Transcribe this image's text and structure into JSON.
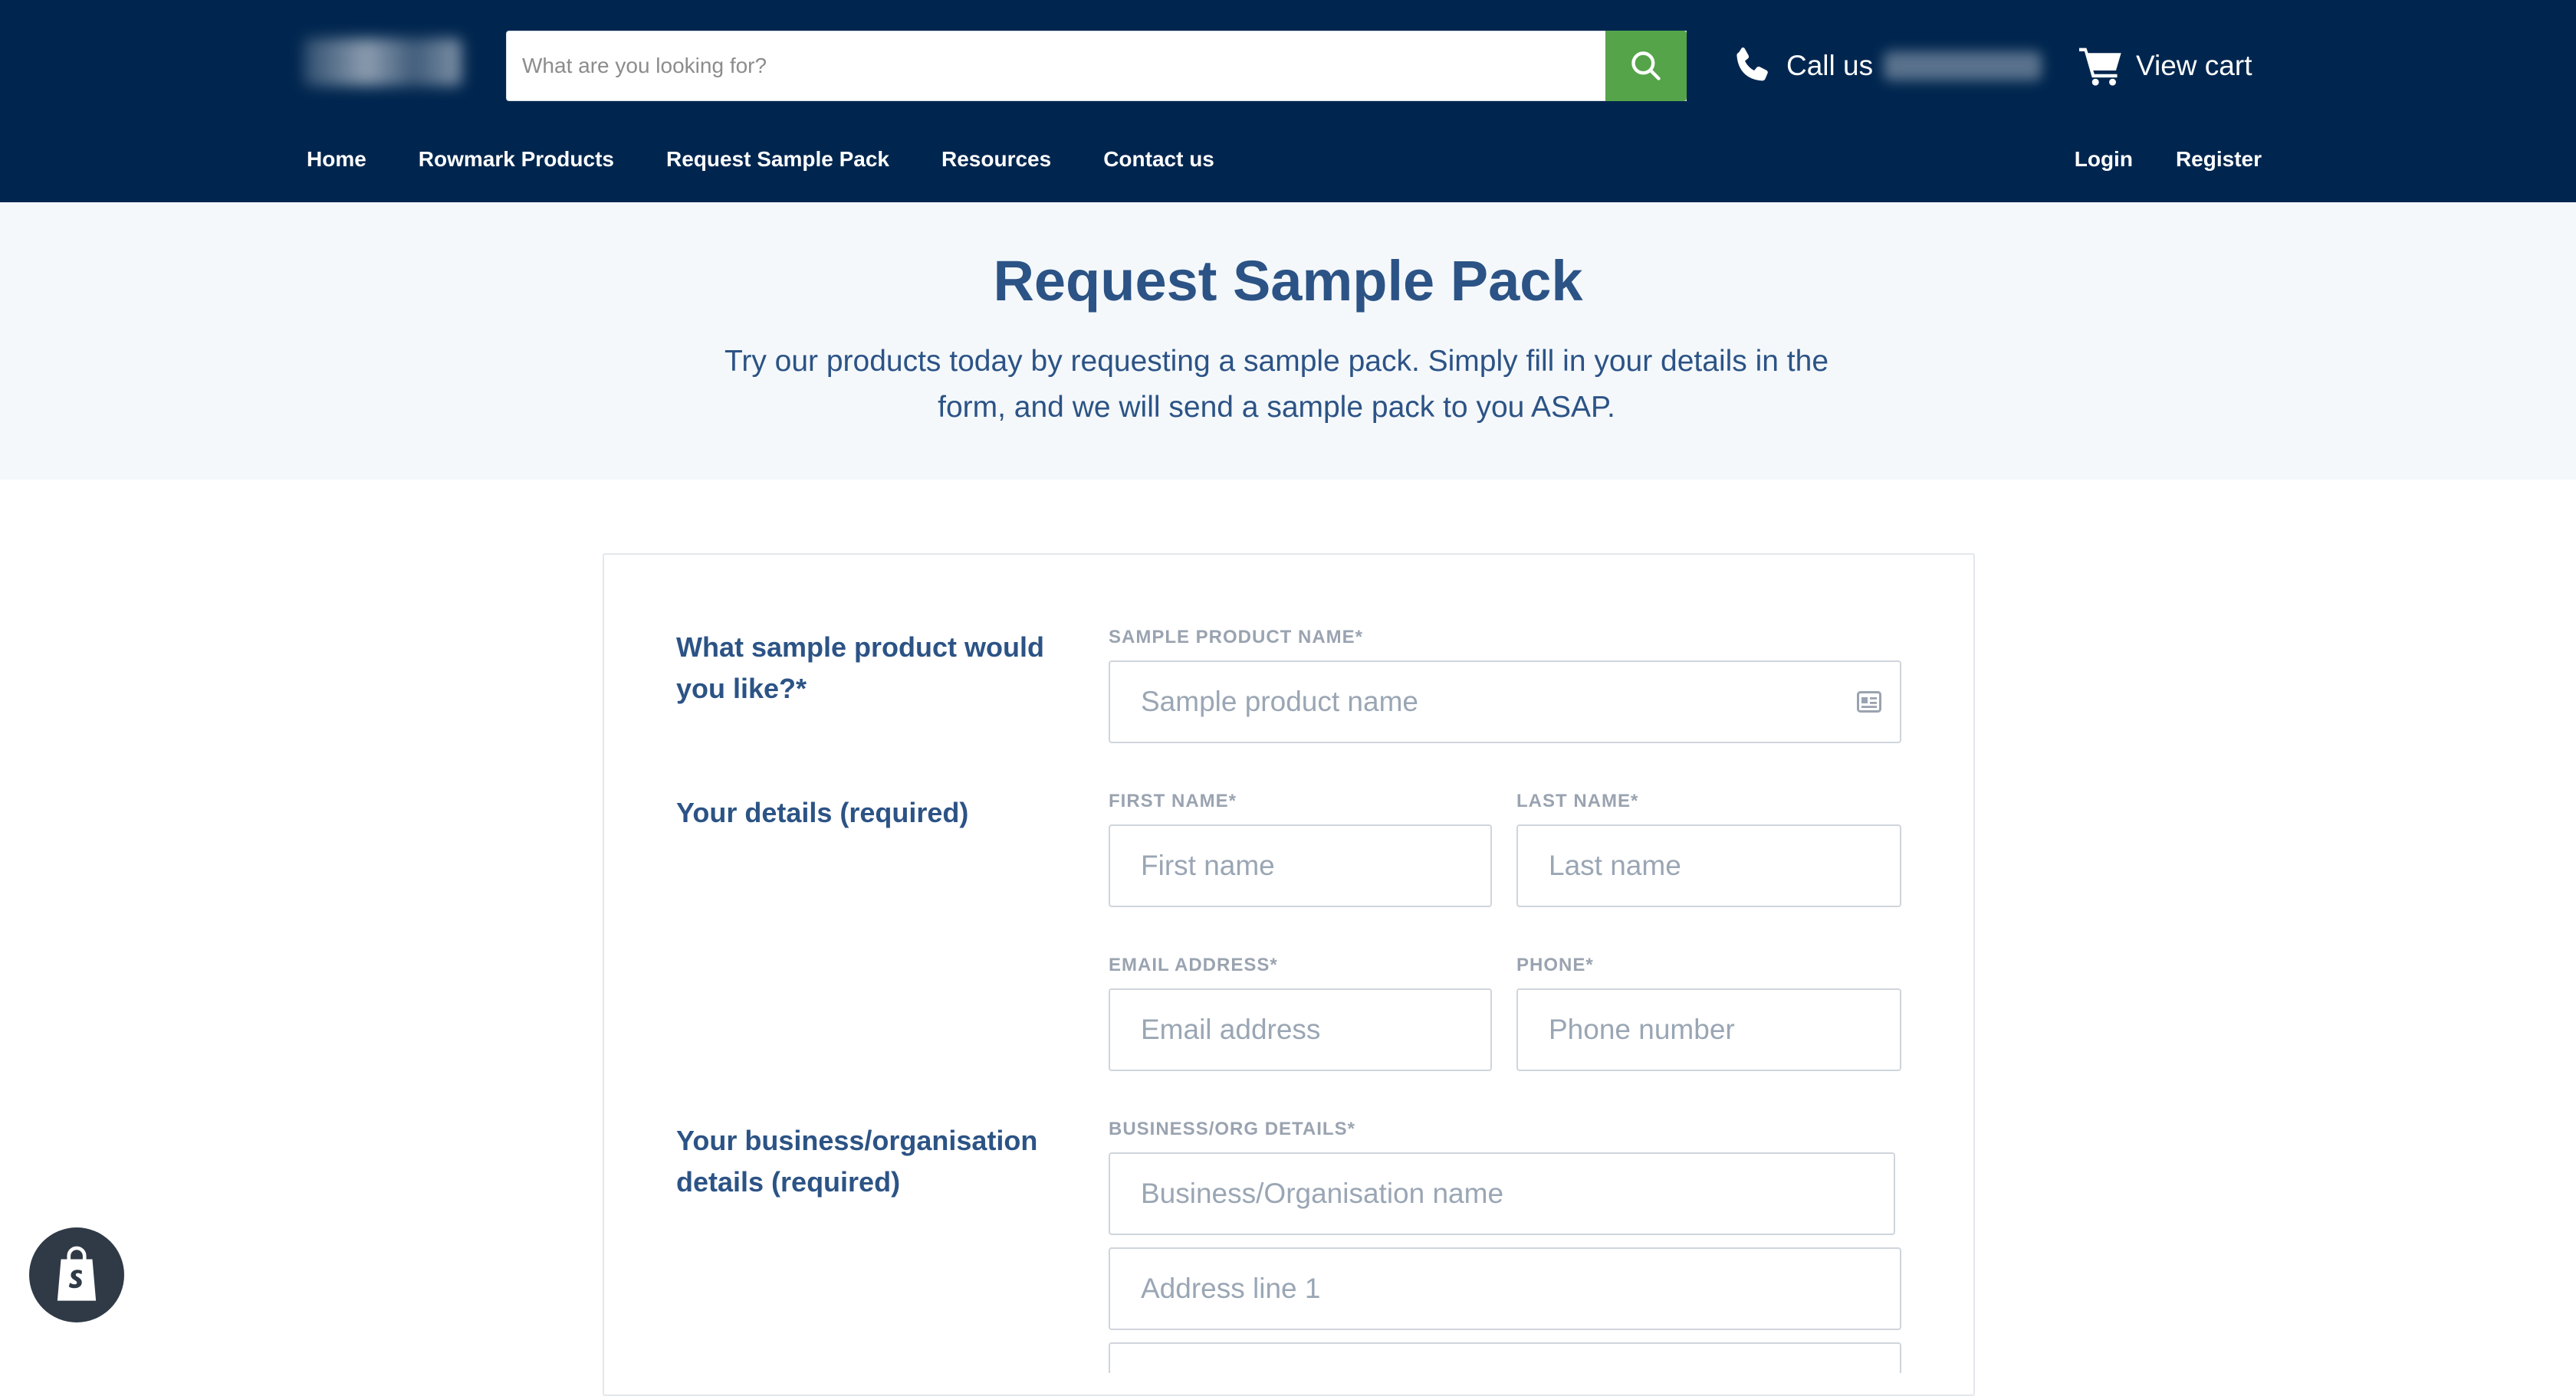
{
  "header": {
    "search": {
      "placeholder": "What are you looking for?"
    },
    "call_label": "Call us",
    "cart_label": "View cart",
    "nav": [
      "Home",
      "Rowmark Products",
      "Request Sample Pack",
      "Resources",
      "Contact us"
    ],
    "account": {
      "login": "Login",
      "register": "Register"
    }
  },
  "hero": {
    "title": "Request Sample Pack",
    "description": "Try our products today by requesting a sample pack. Simply fill in your details in the form, and we will send a sample pack to you ASAP."
  },
  "form": {
    "sections": {
      "product": "What sample product would you like?*",
      "details": "Your details (required)",
      "business": "Your business/organisation details (required)"
    },
    "fields": {
      "sample_product": {
        "label": "SAMPLE PRODUCT NAME*",
        "placeholder": "Sample product name"
      },
      "first_name": {
        "label": "FIRST NAME*",
        "placeholder": "First name"
      },
      "last_name": {
        "label": "LAST NAME*",
        "placeholder": "Last name"
      },
      "email": {
        "label": "EMAIL ADDRESS*",
        "placeholder": "Email address"
      },
      "phone": {
        "label": "PHONE*",
        "placeholder": "Phone number"
      },
      "business_label": "BUSINESS/ORG DETAILS*",
      "business_name": {
        "placeholder": "Business/Organisation name"
      },
      "address1": {
        "placeholder": "Address line 1"
      }
    }
  },
  "colors": {
    "header_bg": "#00264f",
    "search_button": "#55a449",
    "heading_blue": "#2c5385",
    "hero_bg": "#f4f8fb",
    "label_gray": "#9aa3b0"
  },
  "icons": {
    "search": "search-icon",
    "phone": "phone-icon",
    "cart": "cart-icon",
    "contact_card": "contact-card-icon",
    "shopify": "shopify-bag-icon"
  }
}
